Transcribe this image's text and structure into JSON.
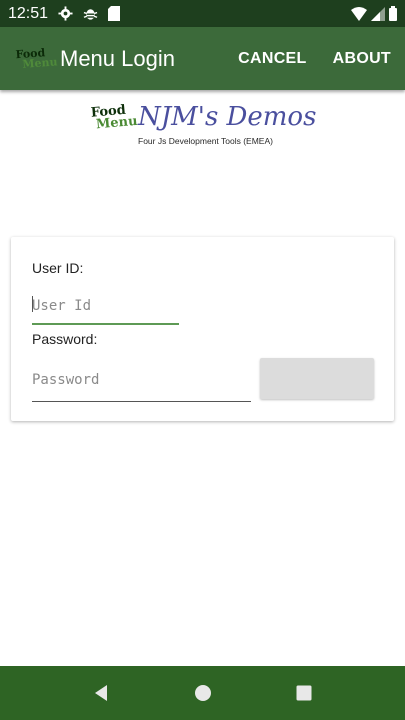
{
  "status_bar": {
    "time": "12:51",
    "icons": [
      "gear-icon",
      "bug-icon",
      "sd-card-icon",
      "wifi-icon",
      "signal-icon",
      "battery-icon"
    ]
  },
  "app_bar": {
    "logo_text_line1": "Food",
    "logo_text_line2": "Menu",
    "title": "Menu Login",
    "cancel_label": "CANCEL",
    "about_label": "ABOUT"
  },
  "brand": {
    "logo_text_line1": "Food",
    "logo_text_line2": "Menu",
    "title": "NJM's Demos",
    "subtitle": "Four Js Development Tools (EMEA)"
  },
  "login_form": {
    "userid_label": "User ID:",
    "userid_placeholder": "User Id",
    "userid_value": "",
    "password_label": "Password:",
    "password_placeholder": "Password",
    "password_value": "",
    "login_button_label": ""
  },
  "nav_bar": {
    "icons": [
      "back-icon",
      "home-icon",
      "recents-icon"
    ]
  },
  "colors": {
    "status_bar_bg": "#1e3f1e",
    "app_bar_bg": "#3c6a3a",
    "nav_bar_bg": "#2e6424",
    "accent_underline": "#5e9a55",
    "brand_title": "#4a4f9e"
  }
}
